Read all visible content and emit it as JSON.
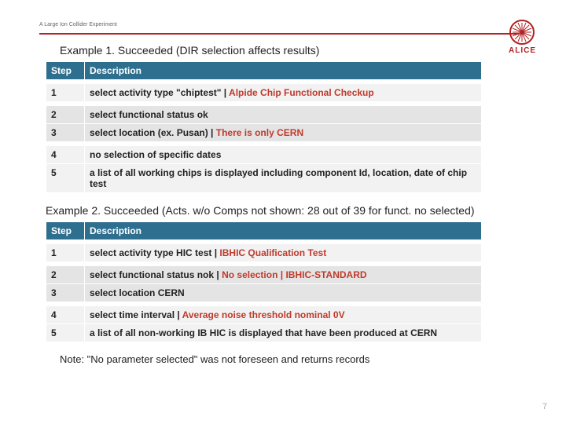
{
  "header": {
    "small_text": "A Large Ion Collider Experiment"
  },
  "logo": {
    "label": "ALICE"
  },
  "example1": {
    "title": "Example 1. Succeeded (DIR selection affects results)",
    "col_step": "Step",
    "col_desc": "Description",
    "rows": [
      {
        "step": "1",
        "desc": "select activity type \"chiptest\" | ",
        "desc_red": "Alpide Chip Functional Checkup"
      },
      {
        "step": "2",
        "desc": "select functional status ok",
        "desc_red": ""
      },
      {
        "step": "3",
        "desc": "select location (ex. Pusan) | ",
        "desc_red": "There is only CERN"
      },
      {
        "step": "4",
        "desc": "no selection of specific dates",
        "desc_red": ""
      },
      {
        "step": "5",
        "desc": "a list of all working chips is displayed including component Id, location, date of chip test",
        "desc_red": ""
      }
    ]
  },
  "example2": {
    "title": "Example 2. Succeeded (Acts. w/o Comps not shown: 28 out of 39 for funct. no selected)",
    "col_step": "Step",
    "col_desc": "Description",
    "rows": [
      {
        "step": "1",
        "desc": "select activity type HIC test | ",
        "desc_red": "IBHIC Qualification Test"
      },
      {
        "step": "2",
        "desc": "select functional status nok | ",
        "desc_red": "No selection | IBHIC-STANDARD"
      },
      {
        "step": "3",
        "desc": "select location CERN",
        "desc_red": ""
      },
      {
        "step": "4",
        "desc": "select time interval | ",
        "desc_red": "Average noise threshold nominal 0V"
      },
      {
        "step": "5",
        "desc": "a list of all non-working IB HIC is displayed that have been produced at CERN",
        "desc_red": ""
      }
    ],
    "note": "Note: \"No parameter selected\" was not foreseen and returns records"
  },
  "page_number": "7"
}
